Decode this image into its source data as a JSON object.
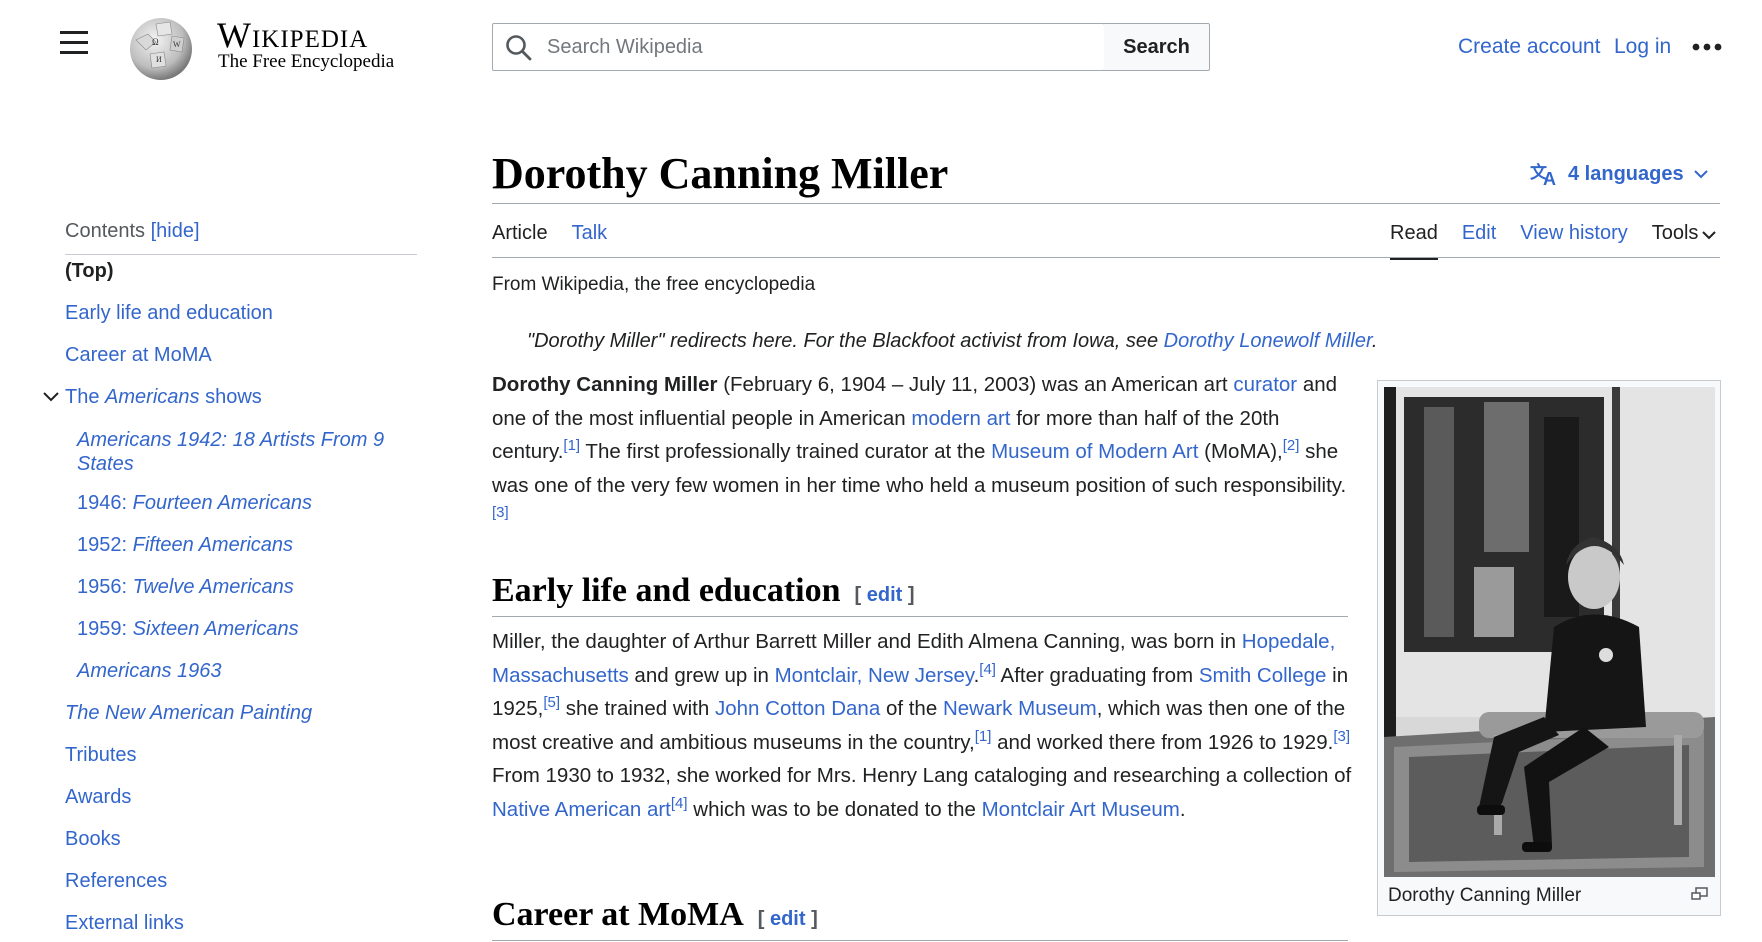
{
  "header": {
    "wordmark": "Wikipedia",
    "tagline": "The Free Encyclopedia",
    "search_placeholder": "Search Wikipedia",
    "search_button": "Search",
    "create_account": "Create account",
    "log_in": "Log in"
  },
  "toc": {
    "heading": "Contents",
    "hide": "[hide]",
    "items": [
      {
        "label": "(Top)"
      },
      {
        "label": "Early life and education"
      },
      {
        "label": "Career at MoMA"
      },
      {
        "label_pre": "The ",
        "label_em": "Americans",
        "label_post": " shows"
      },
      {
        "label_em": "Americans 1942: 18 Artists From 9",
        "label_em2": "States"
      },
      {
        "label_pre": "1946: ",
        "label_em": "Fourteen Americans"
      },
      {
        "label_pre": "1952: ",
        "label_em": "Fifteen Americans"
      },
      {
        "label_pre": "1956: ",
        "label_em": "Twelve Americans"
      },
      {
        "label_pre": "1959: ",
        "label_em": "Sixteen Americans"
      },
      {
        "label_em": "Americans 1963"
      },
      {
        "label_em": "The New American Painting"
      },
      {
        "label": "Tributes"
      },
      {
        "label": "Awards"
      },
      {
        "label": "Books"
      },
      {
        "label": "References"
      },
      {
        "label": "External links"
      }
    ]
  },
  "article": {
    "title": "Dorothy Canning Miller",
    "languages": "4 languages",
    "tabs_left": [
      "Article",
      "Talk"
    ],
    "tabs_right": [
      "Read",
      "Edit",
      "View history",
      "Tools"
    ],
    "from": "From Wikipedia, the free encyclopedia",
    "hatnote_pre": "\"Dorothy Miller\" redirects here. For the Blackfoot activist from Iowa, see ",
    "hatnote_link": "Dorothy Lonewolf Miller",
    "hatnote_post": ".",
    "intro": {
      "bold": "Dorothy Canning Miller",
      "t1": " (February 6, 1904 – July 11, 2003) was an American art ",
      "l1": "curator",
      "t2": " and one of the most influential people in American ",
      "l2": "modern art",
      "t3": " for more than half of the 20th century.",
      "r1": "[1]",
      "t4": " The first professionally trained curator at the ",
      "l3": "Museum of Modern Art",
      "t5": " (MoMA),",
      "r2": "[2]",
      "t6": " she was one of the very few women in her time who held a museum position of such responsibility.",
      "r3": "[3]"
    },
    "sections": [
      {
        "title": "Early life and education",
        "edit": "edit",
        "t1": "Miller, the daughter of Arthur Barrett Miller and Edith Almena Canning, was born in ",
        "l1": "Hopedale, Massachusetts",
        "t2": " and grew up in ",
        "l2": "Montclair, New Jersey",
        "t3": ".",
        "r1": "[4]",
        "t4": " After graduating from ",
        "l3": "Smith College",
        "t5": " in 1925,",
        "r2": "[5]",
        "t6": " she trained with ",
        "l4": "John Cotton Dana",
        "t7": " of the ",
        "l5": "Newark Museum",
        "t8": ", which was then one of the most creative and ambitious museums in the country,",
        "r3": "[1]",
        "t9": " and worked there from 1926 to 1929.",
        "r4": "[3]",
        "t10": " From 1930 to 1932, she worked for Mrs. Henry Lang cataloging and researching a collection of ",
        "l6": "Native American art",
        "r5": "[4]",
        "t11": " which was to be donated to the ",
        "l7": "Montclair Art Museum",
        "t12": "."
      },
      {
        "title": "Career at MoMA",
        "edit": "edit"
      }
    ],
    "image_caption": "Dorothy Canning Miller"
  }
}
